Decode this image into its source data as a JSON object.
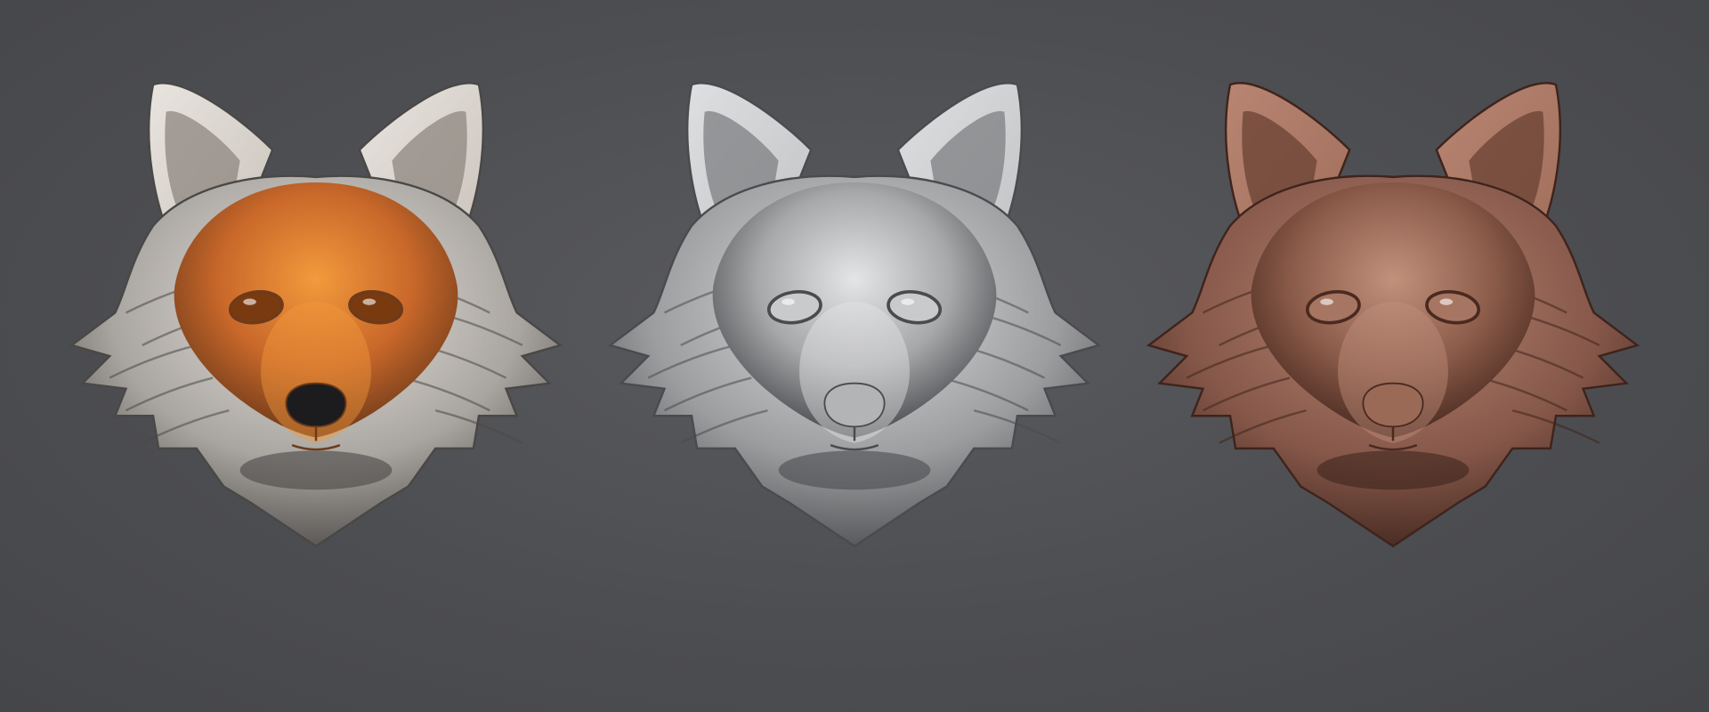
{
  "scene": {
    "background": "#4e4f53",
    "busts": [
      {
        "id": "painted",
        "material": "painted",
        "colors": {
          "base": "#c9682a",
          "light": "#f29a3c",
          "dark": "#6e3a1a",
          "fur": "#a9a5a0",
          "furLight": "#e9e4df",
          "furDark": "#4a4846",
          "ear": "#c9c3bb",
          "earInner": "#8e8780",
          "eye": "#7a3a10",
          "nose": "#1c1c1e"
        }
      },
      {
        "id": "clay-grey",
        "material": "matcap-grey",
        "colors": {
          "base": "#a7a8aa",
          "light": "#e4e5e7",
          "dark": "#4a4b4e",
          "fur": "#9c9d9f",
          "furLight": "#dedfe1",
          "furDark": "#4a4b4e",
          "ear": "#c2c3c5",
          "earInner": "#7e7f82",
          "eye": "#c9cacc",
          "nose": "#b3b4b6"
        }
      },
      {
        "id": "clay-brown",
        "material": "matcap-brown",
        "colors": {
          "base": "#8e5e4c",
          "light": "#c2917c",
          "dark": "#4a2a20",
          "fur": "#86584a",
          "furLight": "#b88572",
          "furDark": "#3e241c",
          "ear": "#a06e5b",
          "earInner": "#6a4233",
          "eye": "#a67662",
          "nose": "#9a6a57"
        }
      }
    ]
  }
}
